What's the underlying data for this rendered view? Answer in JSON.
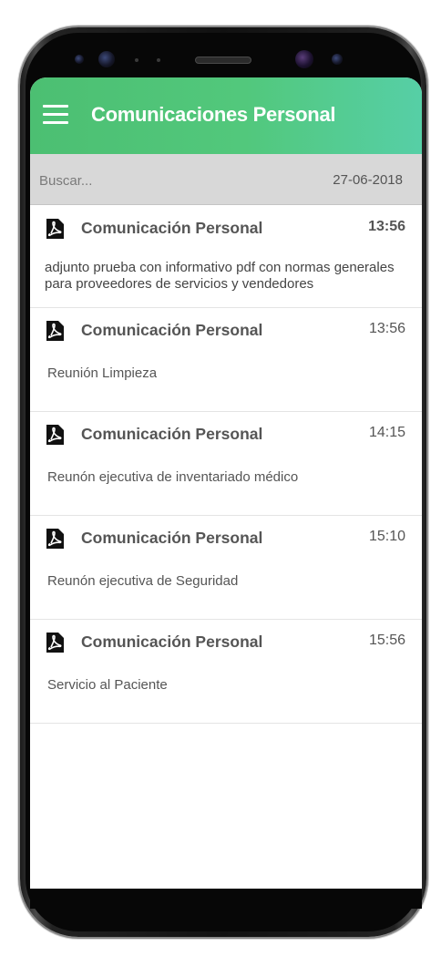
{
  "app": {
    "title": "Comunicaciones Personal",
    "accent_color": "#52c87c"
  },
  "search": {
    "placeholder": "Buscar...",
    "date": "27-06-2018"
  },
  "items": [
    {
      "icon": "pdf-icon",
      "title": "Comunicación Personal",
      "time": "13:56",
      "description": "adjunto prueba con informativo pdf con normas generales para proveedores de servicios y vendedores"
    },
    {
      "icon": "pdf-icon",
      "title": "Comunicación Personal",
      "time": "13:56",
      "description": "Reunión Limpieza"
    },
    {
      "icon": "pdf-icon",
      "title": "Comunicación Personal",
      "time": "14:15",
      "description": "Reunón ejecutiva de inventariado médico"
    },
    {
      "icon": "pdf-icon",
      "title": "Comunicación Personal",
      "time": "15:10",
      "description": "Reunón ejecutiva de Seguridad"
    },
    {
      "icon": "pdf-icon",
      "title": "Comunicación Personal",
      "time": "15:56",
      "description": "Servicio al Paciente"
    }
  ]
}
